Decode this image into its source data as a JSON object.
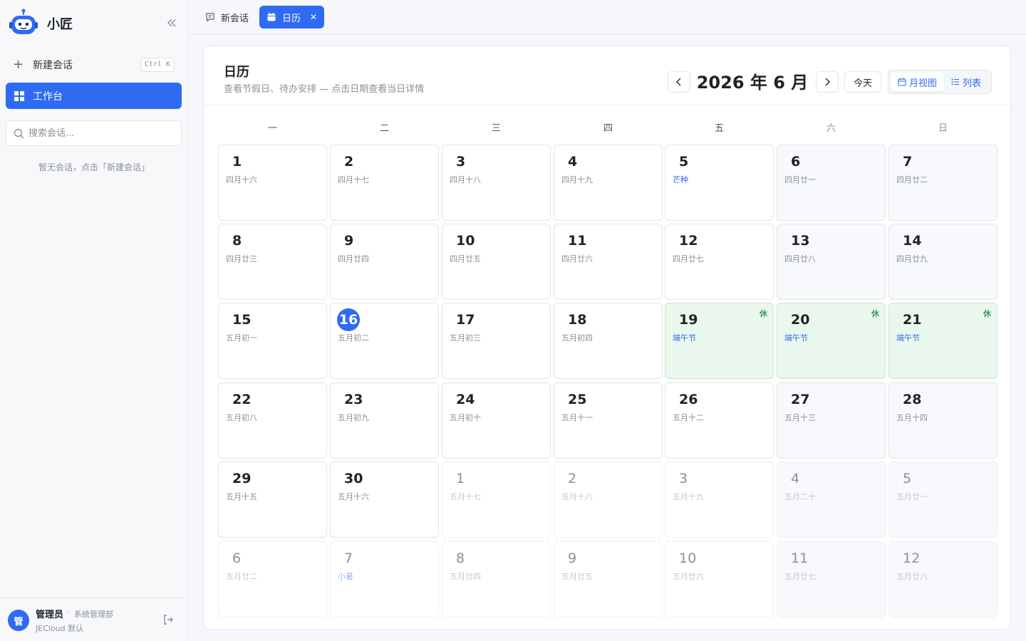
{
  "app": {
    "name": "小匠"
  },
  "sidebar": {
    "new_chat_label": "新建会话",
    "shortcut": "Ctrl K",
    "workbench_label": "工作台",
    "search_placeholder": "搜索会话...",
    "empty_hint": "暂无会话，点击「新建会话」",
    "user": {
      "avatar": "管",
      "name": "管理员",
      "separator": "·",
      "dept": "系统管理部",
      "org": "JECloud 默认"
    }
  },
  "tabs": [
    {
      "label": "新会话",
      "active": false
    },
    {
      "label": "日历",
      "active": true
    }
  ],
  "calendar": {
    "title": "日历",
    "subtitle": "查看节假日、待办安排 — 点击日期查看当日详情",
    "month_title": "2026 年 6 月",
    "today_label": "今天",
    "views": [
      "月视图",
      "列表"
    ],
    "weekdays": [
      "一",
      "二",
      "三",
      "四",
      "五",
      "六",
      "日"
    ],
    "days": [
      {
        "num": "1",
        "lunar": "四月十六"
      },
      {
        "num": "2",
        "lunar": "四月十七"
      },
      {
        "num": "3",
        "lunar": "四月十八"
      },
      {
        "num": "4",
        "lunar": "四月十九"
      },
      {
        "num": "5",
        "lunar": "芒种",
        "term": true
      },
      {
        "num": "6",
        "lunar": "四月廿一"
      },
      {
        "num": "7",
        "lunar": "四月廿二"
      },
      {
        "num": "8",
        "lunar": "四月廿三"
      },
      {
        "num": "9",
        "lunar": "四月廿四"
      },
      {
        "num": "10",
        "lunar": "四月廿五"
      },
      {
        "num": "11",
        "lunar": "四月廿六"
      },
      {
        "num": "12",
        "lunar": "四月廿七"
      },
      {
        "num": "13",
        "lunar": "四月廿八"
      },
      {
        "num": "14",
        "lunar": "四月廿九"
      },
      {
        "num": "15",
        "lunar": "五月初一"
      },
      {
        "num": "16",
        "lunar": "五月初二",
        "today": true
      },
      {
        "num": "17",
        "lunar": "五月初三"
      },
      {
        "num": "18",
        "lunar": "五月初四"
      },
      {
        "num": "19",
        "lunar": "端午节",
        "term": true,
        "holiday": true,
        "badge": "休"
      },
      {
        "num": "20",
        "lunar": "端午节",
        "term": true,
        "holiday": true,
        "badge": "休"
      },
      {
        "num": "21",
        "lunar": "端午节",
        "term": true,
        "holiday": true,
        "badge": "休"
      },
      {
        "num": "22",
        "lunar": "五月初八"
      },
      {
        "num": "23",
        "lunar": "五月初九"
      },
      {
        "num": "24",
        "lunar": "五月初十"
      },
      {
        "num": "25",
        "lunar": "五月十一"
      },
      {
        "num": "26",
        "lunar": "五月十二"
      },
      {
        "num": "27",
        "lunar": "五月十三"
      },
      {
        "num": "28",
        "lunar": "五月十四"
      },
      {
        "num": "29",
        "lunar": "五月十五"
      },
      {
        "num": "30",
        "lunar": "五月十六"
      },
      {
        "num": "1",
        "lunar": "五月十七",
        "other": true
      },
      {
        "num": "2",
        "lunar": "五月十八",
        "other": true
      },
      {
        "num": "3",
        "lunar": "五月十九",
        "other": true
      },
      {
        "num": "4",
        "lunar": "五月二十",
        "other": true
      },
      {
        "num": "5",
        "lunar": "五月廿一",
        "other": true
      },
      {
        "num": "6",
        "lunar": "五月廿二",
        "other": true
      },
      {
        "num": "7",
        "lunar": "小暑",
        "term": true,
        "other": true
      },
      {
        "num": "8",
        "lunar": "五月廿四",
        "other": true
      },
      {
        "num": "9",
        "lunar": "五月廿五",
        "other": true
      },
      {
        "num": "10",
        "lunar": "五月廿六",
        "other": true
      },
      {
        "num": "11",
        "lunar": "五月廿七",
        "other": true
      },
      {
        "num": "12",
        "lunar": "五月廿八",
        "other": true
      }
    ]
  },
  "colors": {
    "accent": "#2f6bf2",
    "holiday_bg": "#eaf7ed",
    "holiday_badge": "#2fa35a"
  },
  "icons": {
    "collapse": "double-chevron-left-icon",
    "new": "plus-icon",
    "workbench": "grid-icon",
    "search": "search-icon",
    "chat": "chat-bubble-icon",
    "calendar": "calendar-icon",
    "close": "close-icon",
    "prev": "chevron-left-icon",
    "next": "chevron-right-icon",
    "list": "list-icon",
    "logout": "logout-icon"
  }
}
